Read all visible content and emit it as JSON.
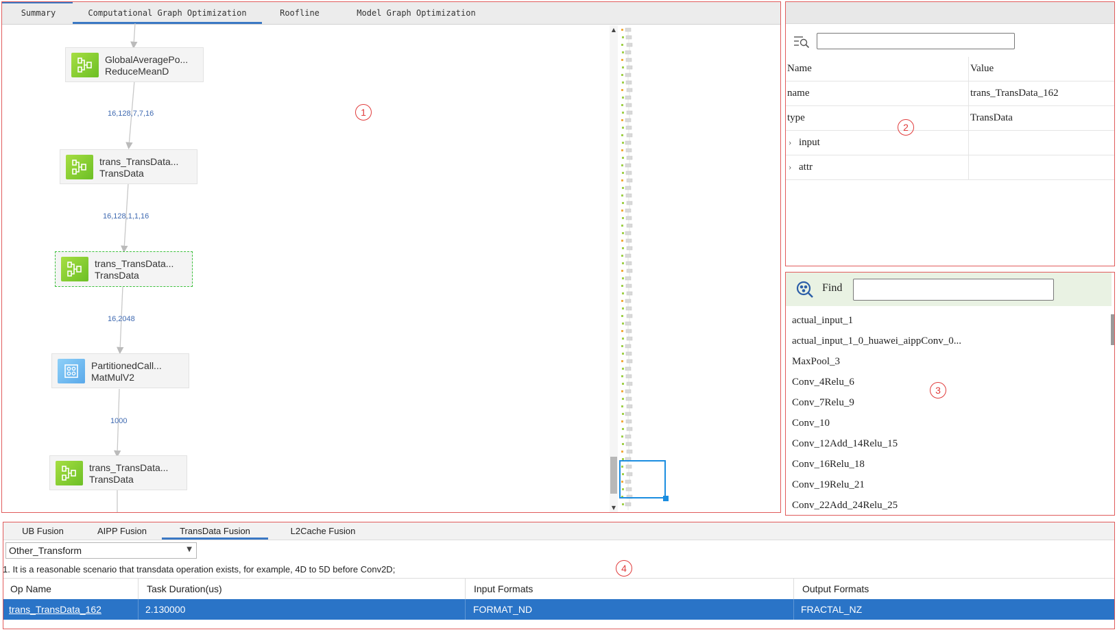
{
  "graph_panel": {
    "tabs": [
      "Summary",
      "Computational Graph Optimization",
      "Roofline",
      "Model Graph Optimization"
    ],
    "active_tab": "Computational Graph Optimization",
    "nodes": [
      {
        "name": "GlobalAveragePo...",
        "type": "ReduceMeanD",
        "icon": "fusion-op-icon"
      },
      {
        "name": "trans_TransData...",
        "type": "TransData",
        "icon": "fusion-op-icon"
      },
      {
        "name": "trans_TransData...",
        "type": "TransData",
        "icon": "fusion-op-icon",
        "selected": true
      },
      {
        "name": "PartitionedCall...",
        "type": "MatMulV2",
        "icon": "matmul-op-icon"
      },
      {
        "name": "trans_TransData...",
        "type": "TransData",
        "icon": "fusion-op-icon"
      }
    ],
    "edge_labels": [
      "16,128,7,7,16",
      "16,128,1,1,16",
      "16,2048",
      "1000"
    ]
  },
  "annotations": [
    "1",
    "2",
    "3",
    "4"
  ],
  "properties": {
    "search_placeholder": "",
    "columns": [
      "Name",
      "Value"
    ],
    "rows": [
      {
        "name": "name",
        "value": "trans_TransData_162"
      },
      {
        "name": "type",
        "value": "TransData"
      },
      {
        "name": "input",
        "value": "",
        "expandable": true
      },
      {
        "name": "attr",
        "value": "",
        "expandable": true
      }
    ]
  },
  "find_panel": {
    "label": "Find",
    "input_value": "",
    "items": [
      "actual_input_1",
      "actual_input_1_0_huawei_aippConv_0...",
      "MaxPool_3",
      "Conv_4Relu_6",
      "Conv_7Relu_9",
      "Conv_10",
      "Conv_12Add_14Relu_15",
      "Conv_16Relu_18",
      "Conv_19Relu_21",
      "Conv_22Add_24Relu_25"
    ]
  },
  "fusion_panel": {
    "tabs": [
      "UB Fusion",
      "AIPP Fusion",
      "TransData Fusion",
      "L2Cache Fusion"
    ],
    "active_tab": "TransData Fusion",
    "selected_option": "Other_Transform",
    "note": "1. It is a reasonable scenario that transdata operation exists, for example, 4D to 5D before Conv2D;",
    "columns": [
      "Op Name",
      "Task Duration(us)",
      "Input Formats",
      "Output Formats"
    ],
    "rows": [
      {
        "op_name": "trans_TransData_162",
        "task_duration": "2.130000",
        "input_formats": "FORMAT_ND",
        "output_formats": "FRACTAL_NZ"
      }
    ]
  },
  "colors": {
    "accent": "#3a78c4",
    "selected_row": "#2a74c7",
    "annotation_red": "#e03a3a",
    "node_green": "#8fd23a",
    "node_blue": "#6db7f0"
  }
}
